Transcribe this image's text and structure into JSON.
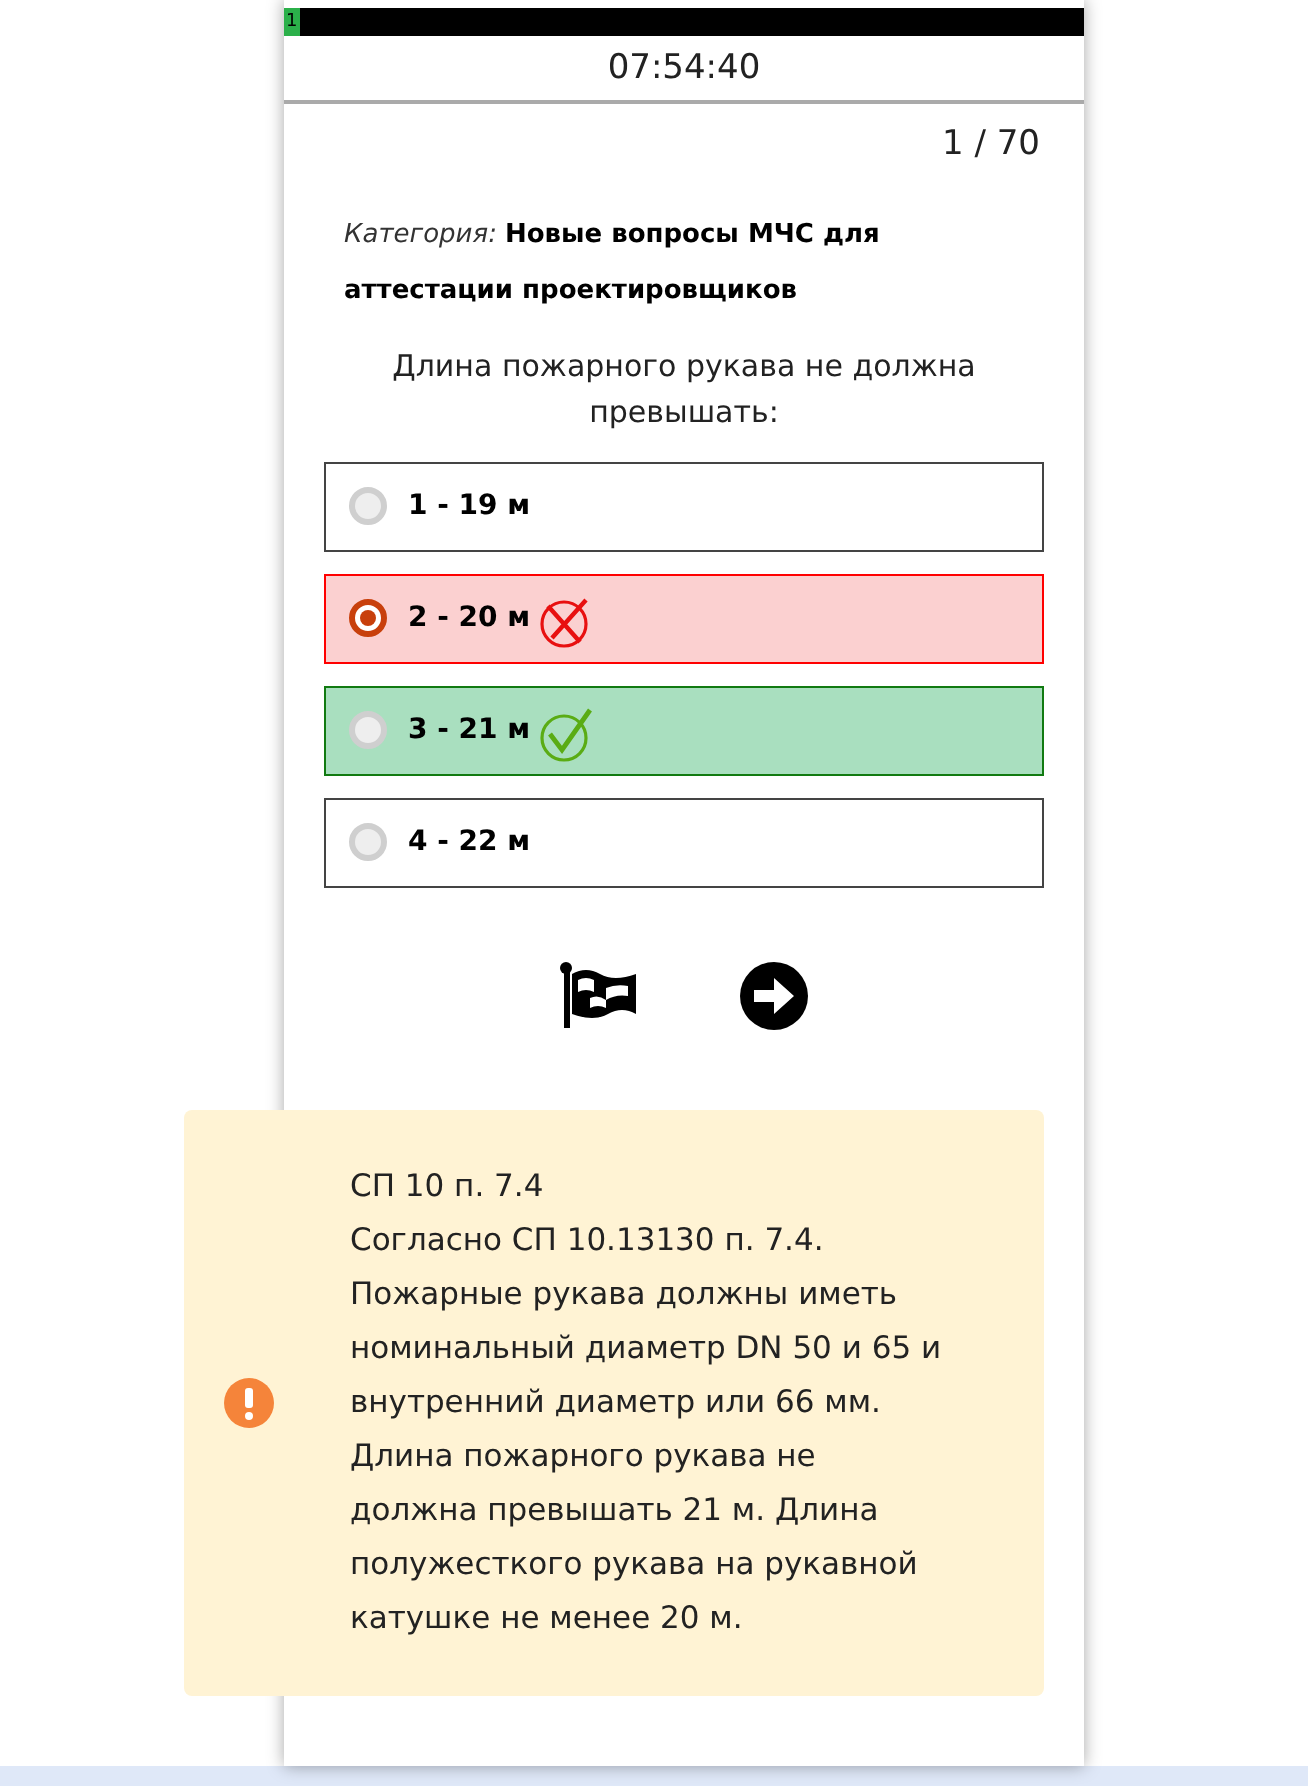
{
  "top_bar": {
    "marker": "1"
  },
  "timer": "07:54:40",
  "counter": "1 / 70",
  "category": {
    "label": "Категория:",
    "value": "Новые вопросы МЧС для аттестации проектировщиков"
  },
  "question": "Длина пожарного рукава не должна превышать:",
  "options": [
    {
      "label": "1 - 19 м",
      "selected": false,
      "kind": "plain"
    },
    {
      "label": "2 - 20 м",
      "selected": true,
      "kind": "wrong"
    },
    {
      "label": "3 - 21 м",
      "selected": false,
      "kind": "correct"
    },
    {
      "label": "4 - 22 м",
      "selected": false,
      "kind": "plain"
    }
  ],
  "explanation": {
    "title": "СП 10 п. 7.4",
    "text": "Согласно СП 10.13130 п. 7.4. Пожарные рукава должны иметь номинальный диаметр DN 50 и 65 и внутренний диаметр или 66 мм. Длина пожарного рукава не должна превышать 21 м. Длина полужесткого рукава на рукавной катушке не менее 20 м."
  }
}
